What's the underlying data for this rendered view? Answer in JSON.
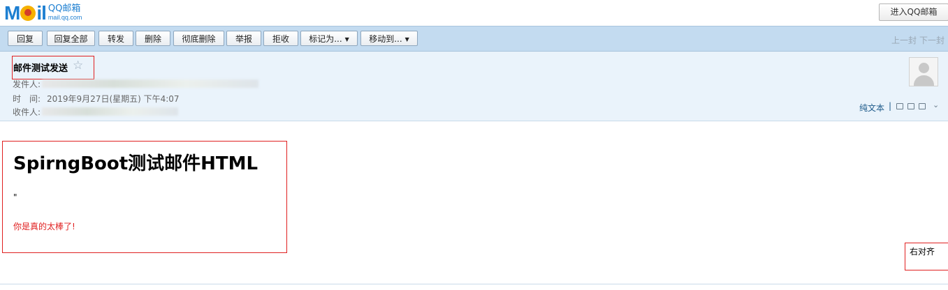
{
  "brand": {
    "logo_text": "Mail",
    "logo_cn": "QQ邮箱",
    "logo_url": "mail.qq.com",
    "accent": "#1d7fd1"
  },
  "header": {
    "enter_button": "进入QQ邮箱"
  },
  "toolbar": {
    "buttons": [
      "回复",
      "回复全部",
      "转发",
      "删除",
      "彻底删除",
      "举报",
      "拒收",
      "标记为...",
      "移动到..."
    ],
    "prev": "上一封",
    "next": "下一封"
  },
  "mail": {
    "subject": "邮件测试发送",
    "sender_label": "发件人:",
    "time_label": "时　间:",
    "time_value": "2019年9月27日(星期五) 下午4:07",
    "recipient_label": "收件人:",
    "plaintext_link": "纯文本",
    "separator": "|"
  },
  "body": {
    "heading": "SpirngBoot测试邮件HTML",
    "quote": "\"",
    "red_text": "你是真的太棒了!",
    "right_text": "右对齐",
    "red_color": "#e02020"
  },
  "icons": [
    "star-icon",
    "avatar-icon",
    "note-icon",
    "folder-icon",
    "print-icon",
    "chevron-down-icon"
  ]
}
